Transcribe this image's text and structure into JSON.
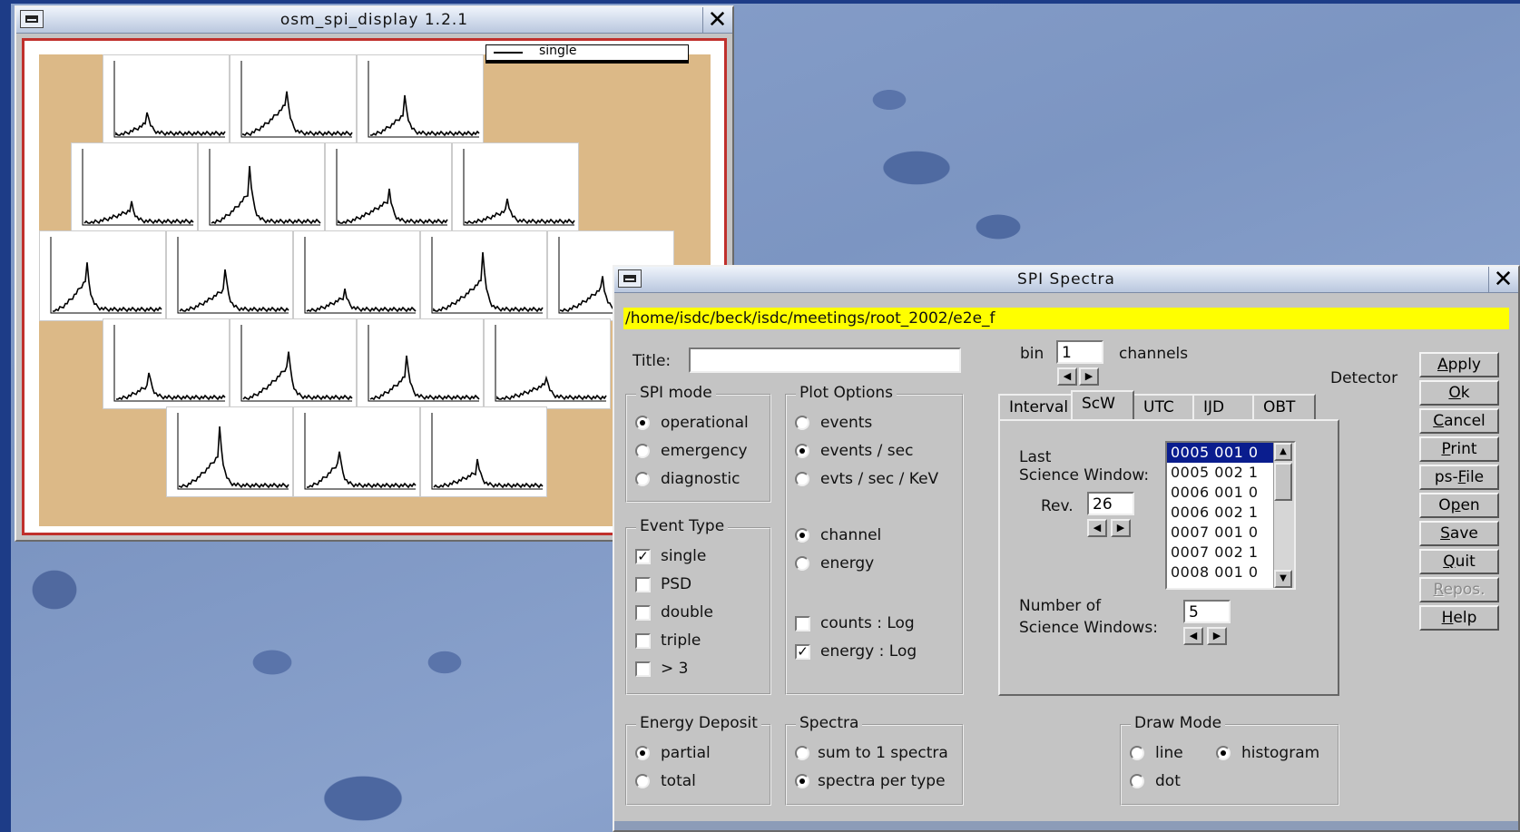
{
  "osm_window": {
    "title": "osm_spi_display  1.2.1",
    "legend_label": "single"
  },
  "spi_window": {
    "title": "SPI Spectra",
    "path": "/home/isdc/beck/isdc/meetings/root_2002/e2e_f",
    "title_label": "Title:",
    "title_value": "",
    "bin_label": "bin",
    "bin_value": "1",
    "channels_label": "channels",
    "detector_label": "Detector",
    "spi_mode": {
      "title": "SPI mode",
      "options": [
        {
          "label": "operational",
          "selected": true
        },
        {
          "label": "emergency",
          "selected": false
        },
        {
          "label": "diagnostic",
          "selected": false
        }
      ]
    },
    "event_type": {
      "title": "Event Type",
      "options": [
        {
          "label": "single",
          "checked": true
        },
        {
          "label": "PSD",
          "checked": false
        },
        {
          "label": "double",
          "checked": false
        },
        {
          "label": "triple",
          "checked": false
        },
        {
          "label": "> 3",
          "checked": false
        }
      ]
    },
    "plot_options": {
      "title": "Plot Options",
      "units": [
        {
          "label": "events",
          "selected": false
        },
        {
          "label": "events / sec",
          "selected": true
        },
        {
          "label": "evts / sec / KeV",
          "selected": false
        }
      ],
      "axis": [
        {
          "label": "channel",
          "selected": true
        },
        {
          "label": "energy",
          "selected": false
        }
      ],
      "log": [
        {
          "label": "counts : Log",
          "checked": false
        },
        {
          "label": "energy : Log",
          "checked": true
        }
      ]
    },
    "tabs": [
      "Interval",
      "ScW",
      "UTC",
      "IJD",
      "OBT"
    ],
    "active_tab": "ScW",
    "scw": {
      "last_label_1": "Last",
      "last_label_2": "Science Window:",
      "rev_label": "Rev.",
      "rev_value": "26",
      "list": [
        "0005 001 0",
        "0005 002 1",
        "0006 001 0",
        "0006 002 1",
        "0007 001 0",
        "0007 002 1",
        "0008 001 0"
      ],
      "selected_index": 0,
      "number_label_1": "Number of",
      "number_label_2": "Science Windows:",
      "number_value": "5"
    },
    "energy_deposit": {
      "title": "Energy Deposit",
      "options": [
        {
          "label": "partial",
          "selected": true
        },
        {
          "label": "total",
          "selected": false
        }
      ]
    },
    "spectra": {
      "title": "Spectra",
      "options": [
        {
          "label": "sum to 1 spectra",
          "selected": false
        },
        {
          "label": "spectra per type",
          "selected": true
        }
      ]
    },
    "draw_mode": {
      "title": "Draw Mode",
      "options": [
        {
          "label": "line",
          "selected": false
        },
        {
          "label": "histogram",
          "selected": true
        },
        {
          "label": "dot",
          "selected": false
        }
      ]
    },
    "buttons": [
      {
        "label": "Apply",
        "underline": "A",
        "enabled": true
      },
      {
        "label": "Ok",
        "underline": "O",
        "enabled": true
      },
      {
        "label": "Cancel",
        "underline": "C",
        "enabled": true
      },
      {
        "label": "Print",
        "underline": "P",
        "enabled": true
      },
      {
        "label": "ps-File",
        "underline": "F",
        "enabled": true
      },
      {
        "label": "Open",
        "underline": "p",
        "enabled": true
      },
      {
        "label": "Save",
        "underline": "S",
        "enabled": true
      },
      {
        "label": "Quit",
        "underline": "Q",
        "enabled": true
      },
      {
        "label": "Repos.",
        "underline": "R",
        "enabled": false
      },
      {
        "label": "Help",
        "underline": "H",
        "enabled": true
      }
    ]
  }
}
